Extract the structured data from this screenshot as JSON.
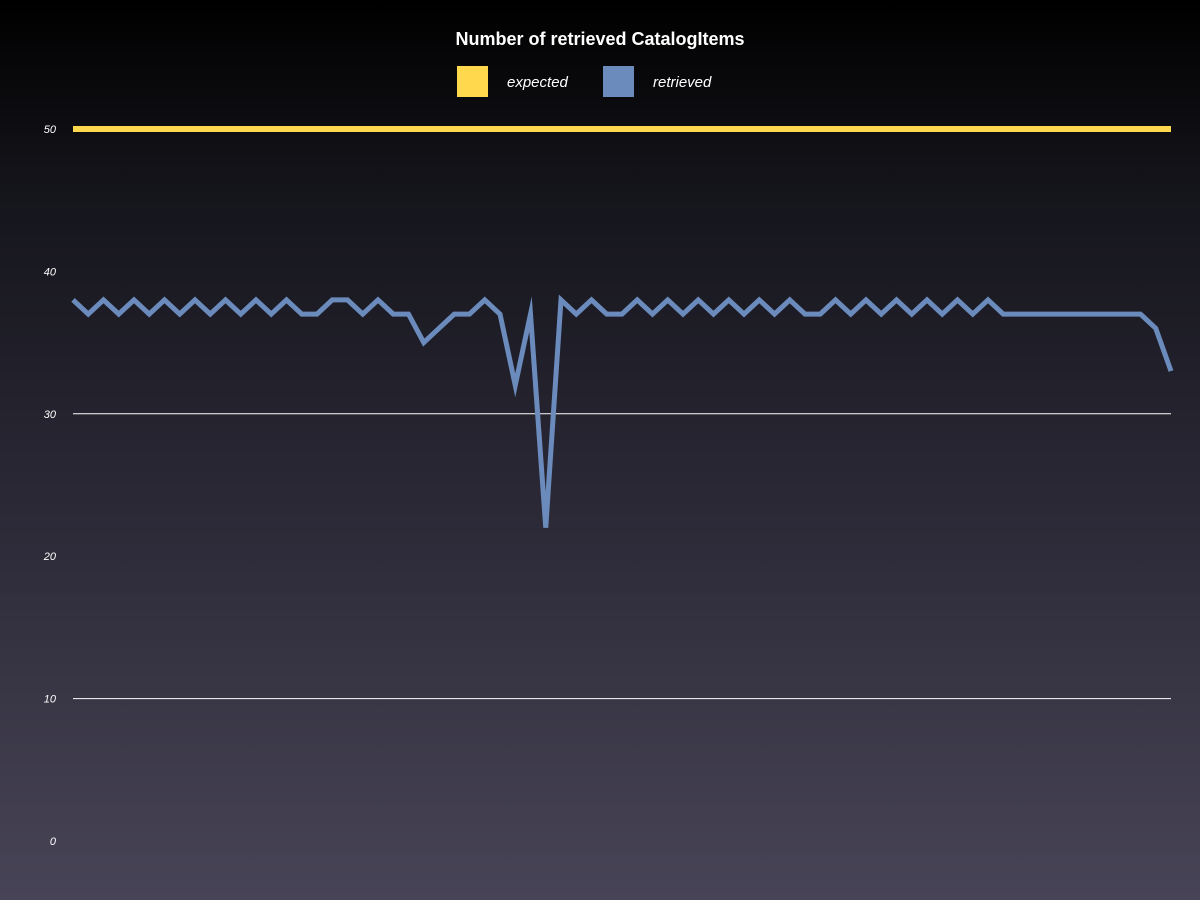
{
  "chart_data": {
    "type": "line",
    "title": "Number of retrieved CatalogItems",
    "xlabel": "",
    "ylabel": "",
    "ylim": [
      0,
      50
    ],
    "yticks": [
      "0",
      "10",
      "20",
      "30",
      "40",
      "50"
    ],
    "gridlines_at": [
      10,
      30
    ],
    "legend_position": "top-center",
    "series": [
      {
        "name": "expected",
        "color": "#ffd84d",
        "values": [
          50,
          50,
          50,
          50,
          50,
          50,
          50,
          50,
          50,
          50,
          50,
          50,
          50,
          50,
          50,
          50,
          50,
          50,
          50,
          50,
          50,
          50,
          50,
          50,
          50,
          50,
          50,
          50,
          50,
          50,
          50,
          50,
          50,
          50,
          50,
          50,
          50,
          50,
          50,
          50,
          50,
          50,
          50,
          50,
          50,
          50,
          50,
          50,
          50,
          50,
          50,
          50,
          50,
          50,
          50,
          50,
          50,
          50,
          50,
          50,
          50,
          50,
          50,
          50,
          50,
          50,
          50,
          50,
          50,
          50,
          50,
          50,
          50
        ]
      },
      {
        "name": "retrieved",
        "color": "#6b8bbd",
        "values": [
          38,
          37,
          38,
          37,
          38,
          37,
          38,
          37,
          38,
          37,
          38,
          37,
          38,
          37,
          38,
          37,
          37,
          38,
          38,
          37,
          38,
          37,
          37,
          35,
          36,
          37,
          37,
          38,
          37,
          32,
          37,
          22,
          38,
          37,
          38,
          37,
          37,
          38,
          37,
          38,
          37,
          38,
          37,
          38,
          37,
          38,
          37,
          38,
          37,
          37,
          38,
          37,
          38,
          37,
          38,
          37,
          38,
          37,
          38,
          37,
          38,
          37,
          37,
          37,
          37,
          37,
          37,
          37,
          37,
          37,
          37,
          36,
          33
        ]
      }
    ]
  }
}
